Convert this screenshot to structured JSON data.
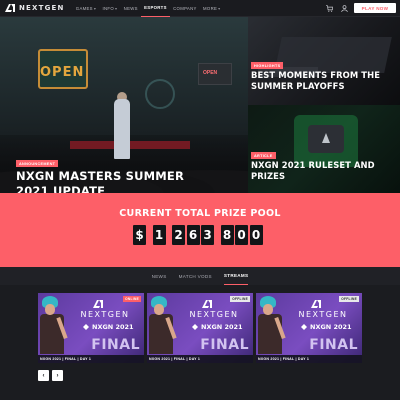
{
  "nav": {
    "logo_text": "NEXTGEN",
    "links": [
      {
        "label": "GAMES",
        "caret": true
      },
      {
        "label": "INFO",
        "caret": true
      },
      {
        "label": "NEWS",
        "caret": false
      },
      {
        "label": "ESPORTS",
        "caret": false,
        "active": true
      },
      {
        "label": "COMPANY",
        "caret": false
      },
      {
        "label": "MORE",
        "caret": true
      }
    ],
    "caret_glyph": "▾",
    "cart_icon": "cart-icon",
    "user_icon": "user-icon",
    "play_button": "PLAY NOW"
  },
  "hero": {
    "main": {
      "tag": "ANNOUNCEMENT",
      "title": "NXGN MASTERS SUMMER 2021 UPDATE",
      "banner_text": "OPEN",
      "screen_text": "OPEN"
    },
    "side1": {
      "tag": "HIGHLIGHTS",
      "title": "BEST MOMENTS FROM THE SUMMER PLAYOFFS"
    },
    "side2": {
      "tag": "ARTICLE",
      "title": "NXGN 2021 RULESET AND PRIZES"
    }
  },
  "prize": {
    "title": "CURRENT TOTAL PRIZE POOL",
    "digits": [
      "$",
      "1",
      "2",
      "6",
      "3",
      "8",
      "0",
      "0"
    ]
  },
  "tabs": [
    {
      "label": "NEWS",
      "active": false
    },
    {
      "label": "MATCH VODS",
      "active": false
    },
    {
      "label": "STREAMS",
      "active": true
    }
  ],
  "streams": [
    {
      "badge": "ONLINE",
      "brand": "NEXTGEN",
      "event": "NXGN 2021",
      "final": "FINAL",
      "caption": "NXGN 2021 | FINAL | DAY 1"
    },
    {
      "badge": "OFFLINE",
      "brand": "NEXTGEN",
      "event": "NXGN 2021",
      "final": "FINAL",
      "caption": "NXGN 2021 | FINAL | DAY 1"
    },
    {
      "badge": "OFFLINE",
      "brand": "NEXTGEN",
      "event": "NXGN 2021",
      "final": "FINAL",
      "caption": "NXGN 2021 | FINAL | DAY 1"
    }
  ],
  "carousel": {
    "prev": "‹",
    "next": "›"
  },
  "colors": {
    "accent": "#fd5f68",
    "background": "#1b1c20",
    "card_purple": "#6a44b0"
  }
}
